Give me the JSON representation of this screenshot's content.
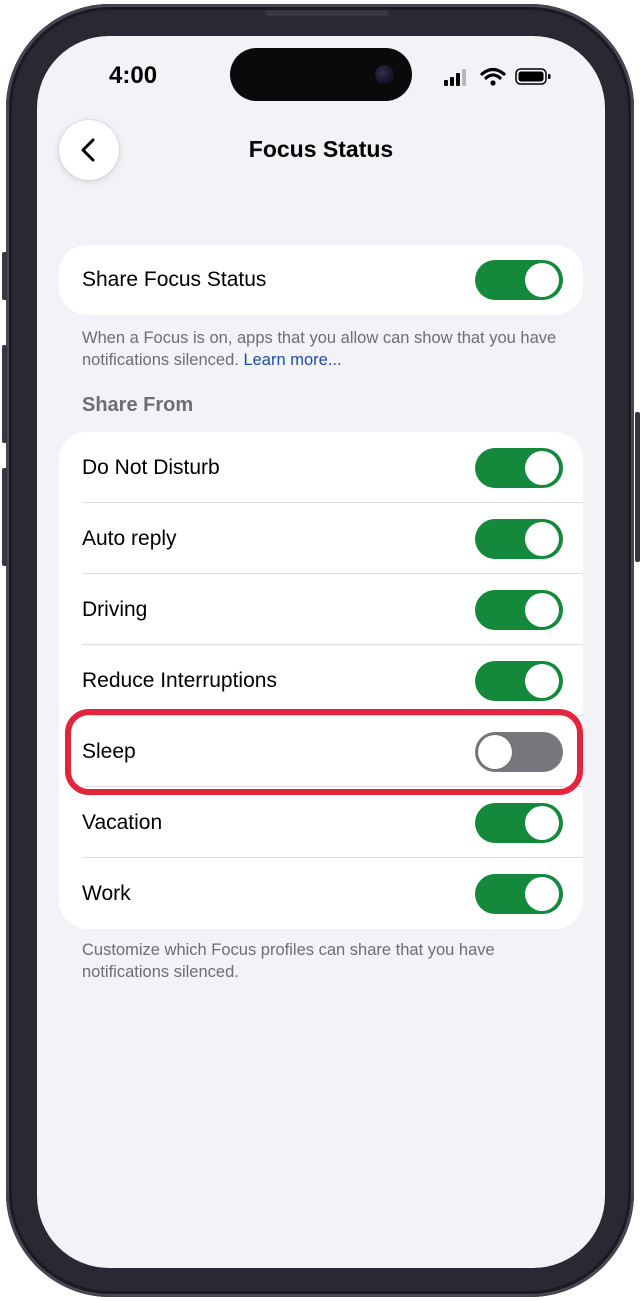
{
  "status_bar": {
    "time": "4:00",
    "icons": [
      "cellular-signal-icon",
      "wifi-icon",
      "battery-icon"
    ]
  },
  "nav": {
    "back_icon": "chevron-left-icon",
    "title": "Focus Status"
  },
  "share_focus": {
    "label": "Share Focus Status",
    "enabled": true,
    "footnote": "When a Focus is on, apps that you allow can show that you have notifications silenced.",
    "link": "Learn more..."
  },
  "share_from": {
    "header": "Share From",
    "items": [
      {
        "label": "Do Not Disturb",
        "enabled": true
      },
      {
        "label": "Auto reply",
        "enabled": true
      },
      {
        "label": "Driving",
        "enabled": true
      },
      {
        "label": "Reduce Interruptions",
        "enabled": true
      },
      {
        "label": "Sleep",
        "enabled": false
      },
      {
        "label": "Vacation",
        "enabled": true
      },
      {
        "label": "Work",
        "enabled": true
      }
    ],
    "footnote": "Customize which Focus profiles can share that you have notifications silenced."
  },
  "colors": {
    "toggle_on": "#14883b",
    "toggle_off": "#76767b",
    "highlight": "#e3243d",
    "link": "#1d4ea0"
  }
}
